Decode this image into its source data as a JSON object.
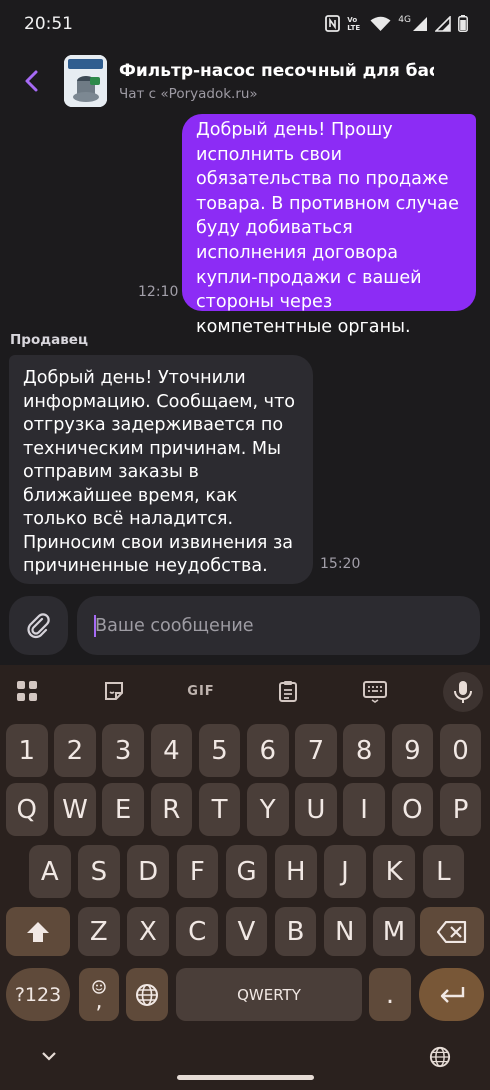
{
  "status_bar": {
    "time": "20:51",
    "network_label": "4G",
    "volte_label": "Vo LTE"
  },
  "header": {
    "back_icon": "chevron-left-icon",
    "title": "Фильтр-насос песочный для бассейна",
    "subtitle": "Чат с «Poryadok.ru»"
  },
  "messages": {
    "outgoing": {
      "text": "Добрый день! Прошу исполнить свои обязательства по продаже товара. В противном случае буду добиваться исполнения договора купли-продажи с вашей стороны через компетентные органы.",
      "time": "12:10"
    },
    "incoming": {
      "sender": "Продавец",
      "text": "Добрый день! Уточнили информацию. Сообщаем, что отгрузка задерживается по техническим причинам. Мы отправим заказы в ближайшее время, как только всё наладится. Приносим свои извинения за причиненные неудобства.",
      "time": "15:20"
    }
  },
  "composer": {
    "attach_icon": "paperclip-icon",
    "placeholder": "Ваше сообщение",
    "value": ""
  },
  "keyboard": {
    "toolbar": {
      "gif_label": "GIF"
    },
    "number_row": [
      "1",
      "2",
      "3",
      "4",
      "5",
      "6",
      "7",
      "8",
      "9",
      "0"
    ],
    "row1": [
      "Q",
      "W",
      "E",
      "R",
      "T",
      "Y",
      "U",
      "I",
      "O",
      "P"
    ],
    "row2": [
      "A",
      "S",
      "D",
      "F",
      "G",
      "H",
      "J",
      "K",
      "L"
    ],
    "row3": [
      "Z",
      "X",
      "C",
      "V",
      "B",
      "N",
      "M"
    ],
    "symbols_label": "?123",
    "comma_label": ",",
    "space_label": "QWERTY",
    "period_label": ".",
    "colors": {
      "accent": "#785737",
      "key": "#4a3e39",
      "background": "#2a211e"
    }
  },
  "colors": {
    "outgoing_bubble": "#8c2cf5",
    "incoming_bubble": "#2c2b30",
    "background": "#1c1b1d",
    "accent": "#a66af5"
  }
}
